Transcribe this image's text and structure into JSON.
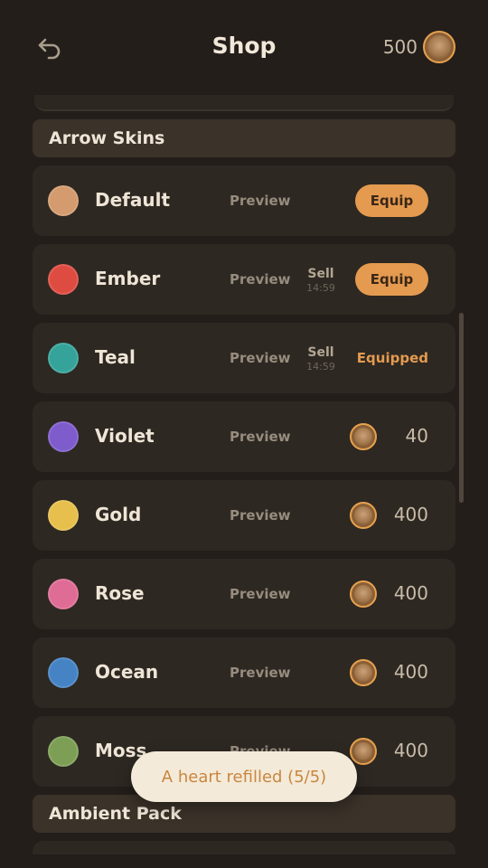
{
  "header": {
    "title": "Shop",
    "balance": "500",
    "back_icon": "back-arrow-icon",
    "coin_icon": "coin-icon"
  },
  "sections": [
    {
      "label": "Arrow Skins",
      "items": [
        {
          "name": "Default",
          "color": "#d39b6e",
          "preview": "Preview",
          "action": "Equip"
        },
        {
          "name": "Ember",
          "color": "#de4c41",
          "preview": "Preview",
          "sell": "Sell",
          "timer": "14:59",
          "action": "Equip"
        },
        {
          "name": "Teal",
          "color": "#35a39a",
          "preview": "Preview",
          "sell": "Sell",
          "timer": "14:59",
          "status": "Equipped"
        },
        {
          "name": "Violet",
          "color": "#7e5ccc",
          "preview": "Preview",
          "price": "40"
        },
        {
          "name": "Gold",
          "color": "#e6bf4c",
          "preview": "Preview",
          "price": "400"
        },
        {
          "name": "Rose",
          "color": "#de6c95",
          "preview": "Preview",
          "price": "400"
        },
        {
          "name": "Ocean",
          "color": "#4583c4",
          "preview": "Preview",
          "price": "400"
        },
        {
          "name": "Moss",
          "color": "#7d9f55",
          "preview": "Preview",
          "price": "400"
        }
      ]
    },
    {
      "label": "Ambient Pack"
    }
  ],
  "toast": {
    "message": "A heart refilled (5/5)"
  },
  "colors": {
    "background": "#231e1a",
    "accent": "#e49a4f",
    "row": "#2d2822",
    "section_header": "#3b3229"
  }
}
